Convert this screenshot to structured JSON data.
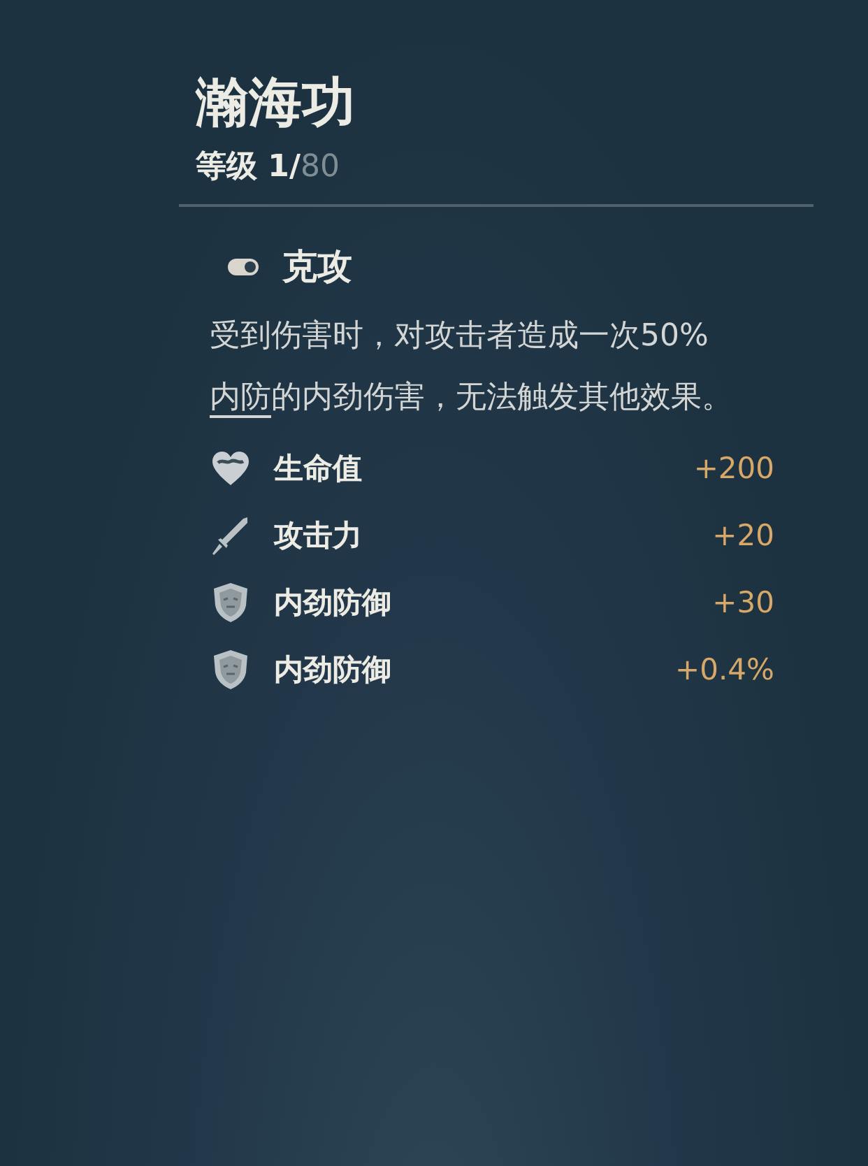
{
  "title": "瀚海功",
  "level": {
    "label": "等级",
    "current": "1/",
    "max": "80"
  },
  "skill": {
    "name": "克攻"
  },
  "description": [
    {
      "kind": "plain",
      "text": "受到伤害时，对攻击者造成一次50%"
    },
    {
      "kind": "term",
      "text": "内防"
    },
    {
      "kind": "plain",
      "text": "的内劲伤害，无法触发其他效果。"
    }
  ],
  "stats": [
    {
      "kind": "heart",
      "label": "生命值",
      "value": "+200"
    },
    {
      "kind": "sword",
      "label": "攻击力",
      "value": "+20"
    },
    {
      "kind": "shield",
      "label": "内劲防御",
      "value": "+30"
    },
    {
      "kind": "shield",
      "label": "内劲防御",
      "value": "+0.4%"
    }
  ]
}
